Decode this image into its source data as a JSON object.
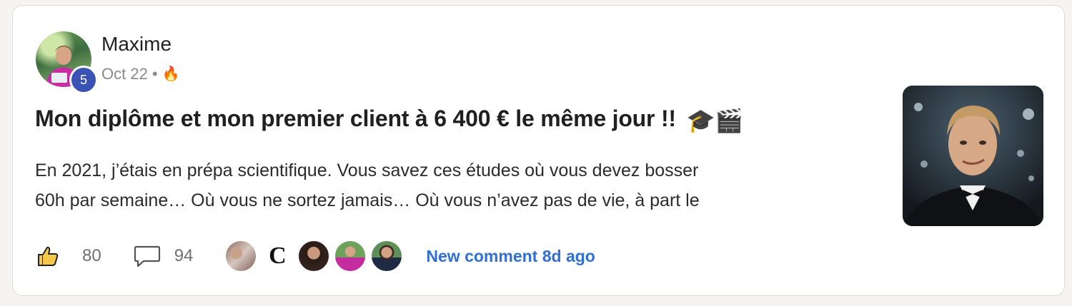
{
  "post": {
    "author": "Maxime",
    "level": "5",
    "date": "Oct 22",
    "separator": "•",
    "title": "Mon diplôme et mon premier client à 6 400 € le même jour !!",
    "title_emojis": "🎓🎬",
    "excerpt_line1": "En 2021, j’étais en prépa scientifique. Vous savez ces études où vous devez bosser",
    "excerpt_line2": "60h par semaine… Où vous ne sortez jamais… Où vous n’avez pas de vie, à part le",
    "likes": "80",
    "comments": "94",
    "new_comment": "New comment 8d ago",
    "commenter_initial": "C"
  },
  "icons": {
    "fire": "fire-icon",
    "like": "thumbs-up-icon",
    "comment": "speech-bubble-icon"
  },
  "colors": {
    "level_badge": "#3b52b5",
    "link": "#2f6fd6"
  }
}
